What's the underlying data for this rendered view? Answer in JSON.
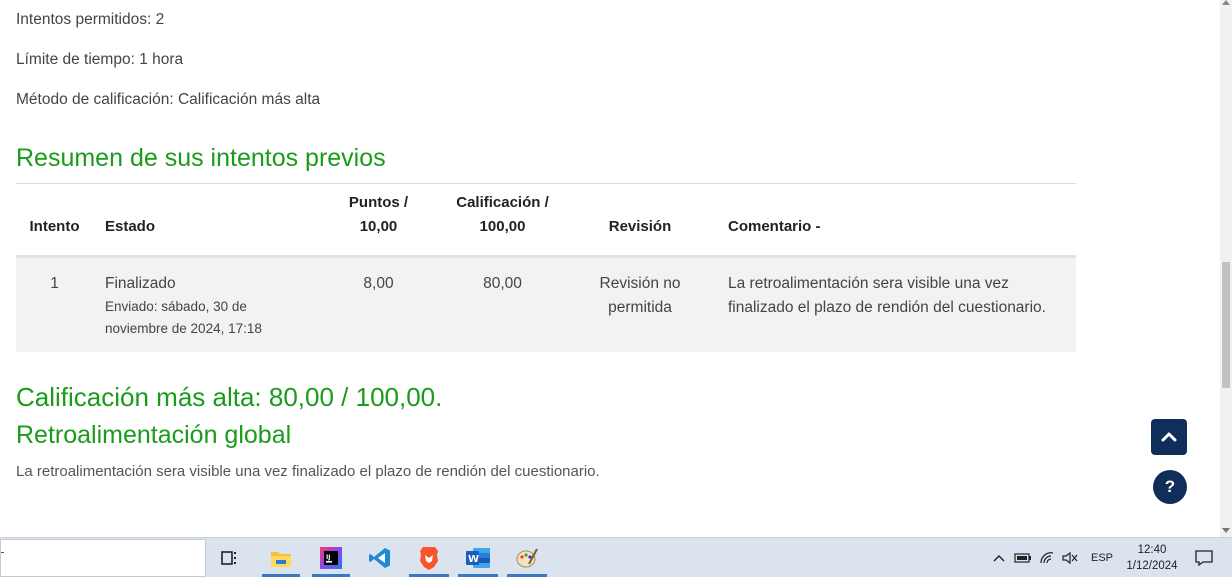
{
  "quiz_info": {
    "attempts_allowed": "Intentos permitidos: 2",
    "time_limit": "Límite de tiempo: 1 hora",
    "grading_method": "Método de calificación: Calificación más alta"
  },
  "summary": {
    "heading": "Resumen de sus intentos previos",
    "columns": {
      "attempt": "Intento",
      "status": "Estado",
      "points_line1": "Puntos /",
      "points_line2": "10,00",
      "grade_line1": "Calificación /",
      "grade_line2": "100,00",
      "review": "Revisión",
      "comment": "Comentario -"
    },
    "rows": [
      {
        "attempt": "1",
        "status": "Finalizado",
        "submitted": "Enviado: sábado, 30 de noviembre de 2024, 17:18",
        "points": "8,00",
        "grade": "80,00",
        "review": "Revisión no permitida",
        "comment": "La retroalimentación sera visible una vez finalizado el plazo de rendión del cuestionario."
      }
    ]
  },
  "best_grade": "Calificación más alta: 80,00 / 100,00.",
  "feedback": {
    "heading": "Retroalimentación global",
    "text": "La retroalimentación sera visible una vez finalizado el plazo de rendión del cuestionario."
  },
  "floating": {
    "help_label": "?"
  },
  "taskbar": {
    "apps": [
      "task-view",
      "file-explorer",
      "intellij",
      "vscode",
      "brave",
      "word",
      "paint"
    ],
    "language": "ESP",
    "time": "12:40",
    "date": "1/12/2024"
  },
  "colors": {
    "heading_green": "#1a9b1a",
    "button_navy": "#0f2e5a",
    "row_bg": "#f2f2f2"
  }
}
